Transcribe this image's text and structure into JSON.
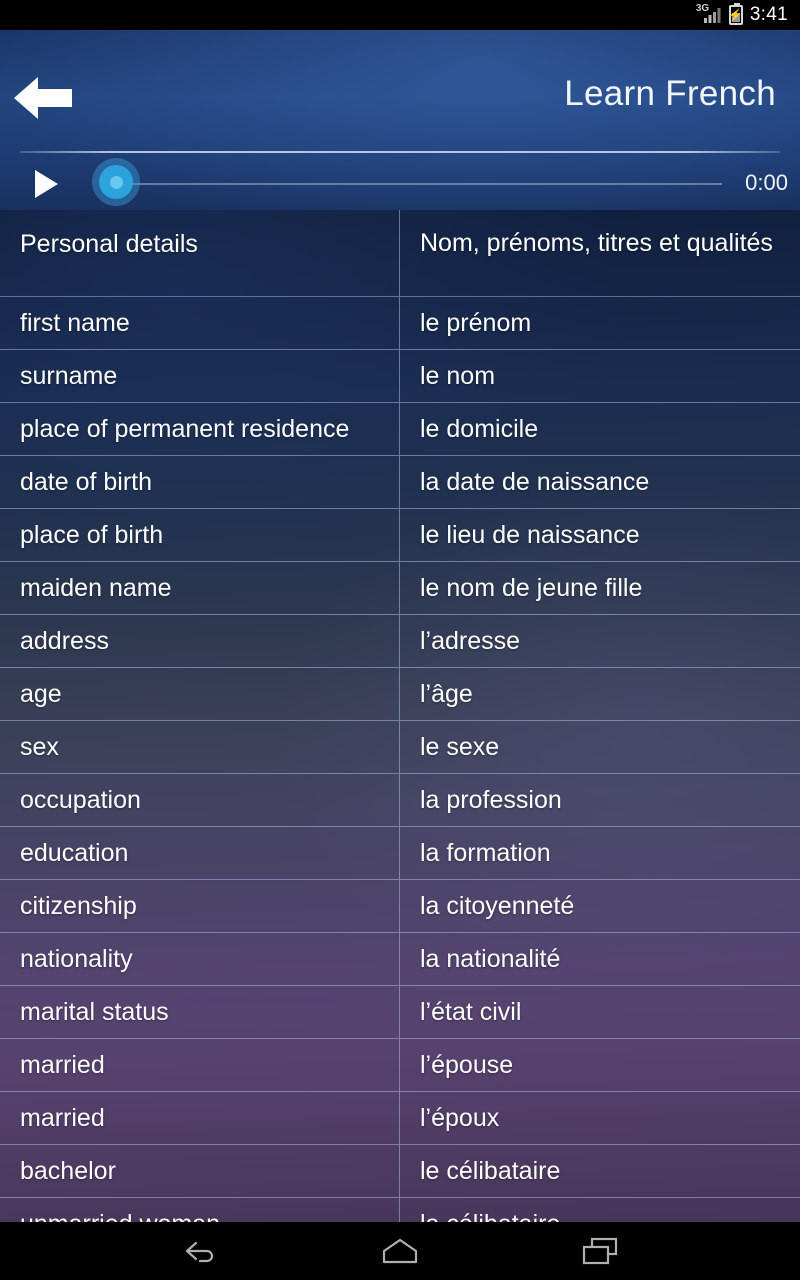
{
  "status_bar": {
    "network_label": "3G",
    "signal_icon": "signal-bars-icon",
    "battery_icon": "battery-charging-icon",
    "time": "3:41"
  },
  "header": {
    "back_icon": "back-arrow-icon",
    "title": "Learn French"
  },
  "player": {
    "play_icon": "play-icon",
    "seek_thumb_icon": "seek-thumb-icon",
    "elapsed_time": "0:00",
    "progress_percent": 0,
    "accent_color": "#2da2dc"
  },
  "table": {
    "header": {
      "en": "Personal details",
      "fr": "Nom, prénoms, titres et qualités"
    },
    "rows": [
      {
        "en": "first name",
        "fr": "le prénom"
      },
      {
        "en": "surname",
        "fr": "le nom"
      },
      {
        "en": "place of permanent residence",
        "fr": "le domicile"
      },
      {
        "en": "date of birth",
        "fr": "la date de naissance"
      },
      {
        "en": "place of birth",
        "fr": "le lieu de naissance"
      },
      {
        "en": "maiden name",
        "fr": "le nom de jeune fille"
      },
      {
        "en": "address",
        "fr": "l’adresse"
      },
      {
        "en": "age",
        "fr": "l’âge"
      },
      {
        "en": "sex",
        "fr": "le sexe"
      },
      {
        "en": "occupation",
        "fr": "la profession"
      },
      {
        "en": "education",
        "fr": "la formation"
      },
      {
        "en": "citizenship",
        "fr": "la citoyenneté"
      },
      {
        "en": "nationality",
        "fr": "la nationalité"
      },
      {
        "en": "marital status",
        "fr": "l’état civil"
      },
      {
        "en": "married",
        "fr": "l’épouse"
      },
      {
        "en": "married",
        "fr": "l’époux"
      },
      {
        "en": "bachelor",
        "fr": "le célibataire"
      },
      {
        "en": "unmarried woman",
        "fr": "la célibataire"
      }
    ]
  },
  "nav_bar": {
    "back_icon": "nav-back-icon",
    "home_icon": "nav-home-icon",
    "recents_icon": "nav-recents-icon"
  }
}
